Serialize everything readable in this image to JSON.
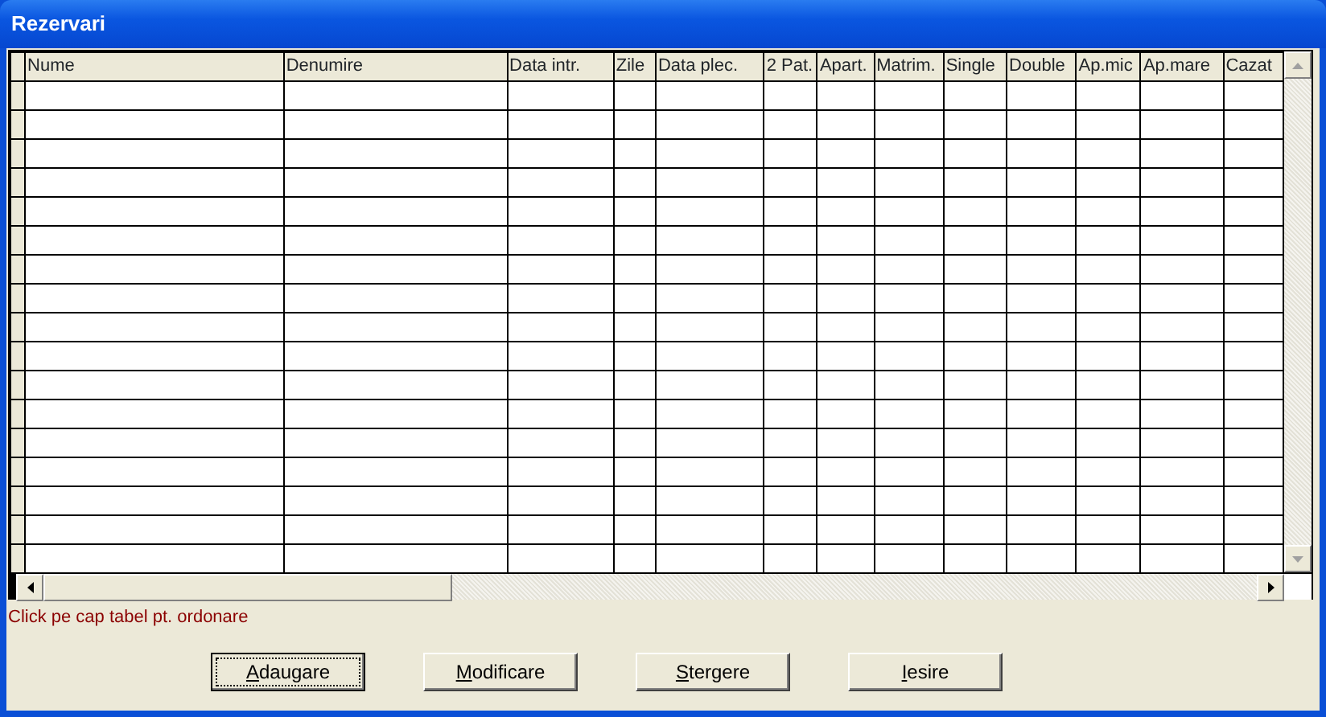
{
  "window": {
    "title": "Rezervari"
  },
  "table": {
    "columns": [
      {
        "label": "Nume"
      },
      {
        "label": "Denumire"
      },
      {
        "label": "Data intr."
      },
      {
        "label": "Zile"
      },
      {
        "label": "Data plec."
      },
      {
        "label": "2 Pat."
      },
      {
        "label": "Apart."
      },
      {
        "label": "Matrim."
      },
      {
        "label": "Single"
      },
      {
        "label": "Double"
      },
      {
        "label": "Ap.mic"
      },
      {
        "label": "Ap.mare"
      },
      {
        "label": "Cazat"
      }
    ]
  },
  "hint": "Click pe cap tabel pt. ordonare",
  "buttons": [
    {
      "label": "Adaugare",
      "mnemonic": true,
      "focused": true
    },
    {
      "label": "Modificare",
      "mnemonic": true,
      "focused": false
    },
    {
      "label": "Stergere",
      "mnemonic": true,
      "focused": false
    },
    {
      "label": "Iesire",
      "mnemonic": true,
      "focused": false
    }
  ]
}
